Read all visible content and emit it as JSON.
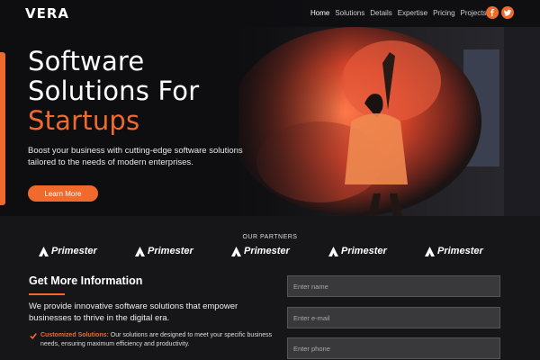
{
  "brand": {
    "logo": "VERA",
    "accent": "#ef6a2c"
  },
  "nav": {
    "items": [
      "Home",
      "Solutions",
      "Details",
      "Expertise",
      "Pricing",
      "Projects"
    ],
    "active": "Home"
  },
  "social": [
    {
      "icon": "facebook-icon",
      "label": "f"
    },
    {
      "icon": "twitter-icon",
      "label": "t"
    }
  ],
  "hero": {
    "title_line1": "Software",
    "title_line2": "Solutions For",
    "title_highlight": "Startups",
    "description": "Boost your business with cutting-edge software solutions tailored to the needs of modern enterprises.",
    "cta_label": "Learn More"
  },
  "partners": {
    "title": "OUR PARTNERS",
    "items": [
      "Primester",
      "Primester",
      "Primester",
      "Primester",
      "Primester"
    ]
  },
  "info": {
    "title": "Get More Information",
    "text": "We provide innovative software solutions that empower businesses to thrive in the digital era.",
    "bullet_title": "Customized Solutions:",
    "bullet_text": " Our solutions are designed to meet your specific business needs, ensuring maximum efficiency and productivity."
  },
  "form": {
    "name_placeholder": "Enter name",
    "email_placeholder": "Enter e-mail",
    "phone_placeholder": "Enter phone"
  }
}
